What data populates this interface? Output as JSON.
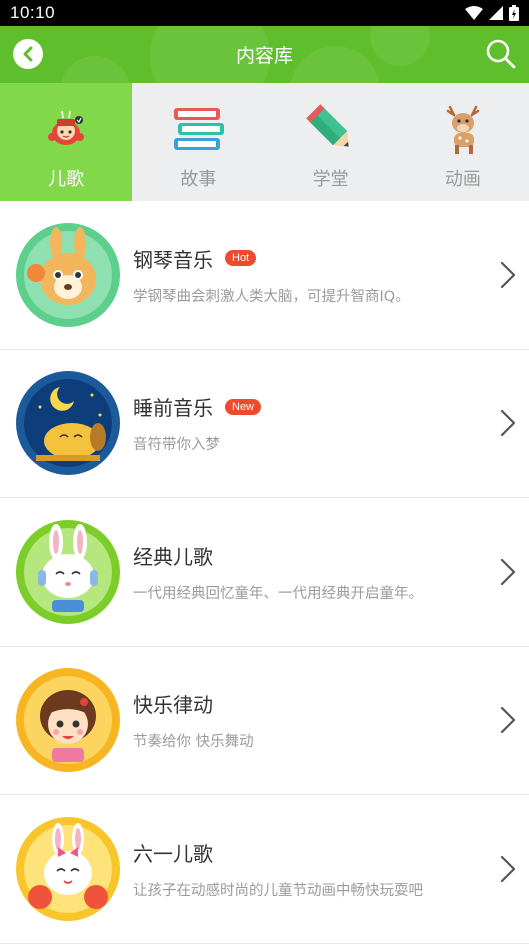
{
  "status_bar": {
    "time": "10:10"
  },
  "app_bar": {
    "title": "内容库"
  },
  "tabs": [
    {
      "label": "儿歌",
      "active": true
    },
    {
      "label": "故事",
      "active": false
    },
    {
      "label": "学堂",
      "active": false
    },
    {
      "label": "动画",
      "active": false
    }
  ],
  "items": [
    {
      "title": "钢琴音乐",
      "badge": "Hot",
      "desc": "学钢琴曲会刺激人类大脑，可提升智商IQ。"
    },
    {
      "title": "睡前音乐",
      "badge": "New",
      "desc": "音符带你入梦"
    },
    {
      "title": "经典儿歌",
      "badge": "",
      "desc": "一代用经典回忆童年、一代用经典开启童年。"
    },
    {
      "title": "快乐律动",
      "badge": "",
      "desc": "节奏给你 快乐舞动"
    },
    {
      "title": "六一儿歌",
      "badge": "",
      "desc": "让孩子在动感时尚的儿童节动画中畅快玩耍吧"
    }
  ],
  "colors": {
    "primary_green": "#5fbe2b",
    "active_tab": "#82d84b",
    "badge_red": "#f04a2c"
  }
}
